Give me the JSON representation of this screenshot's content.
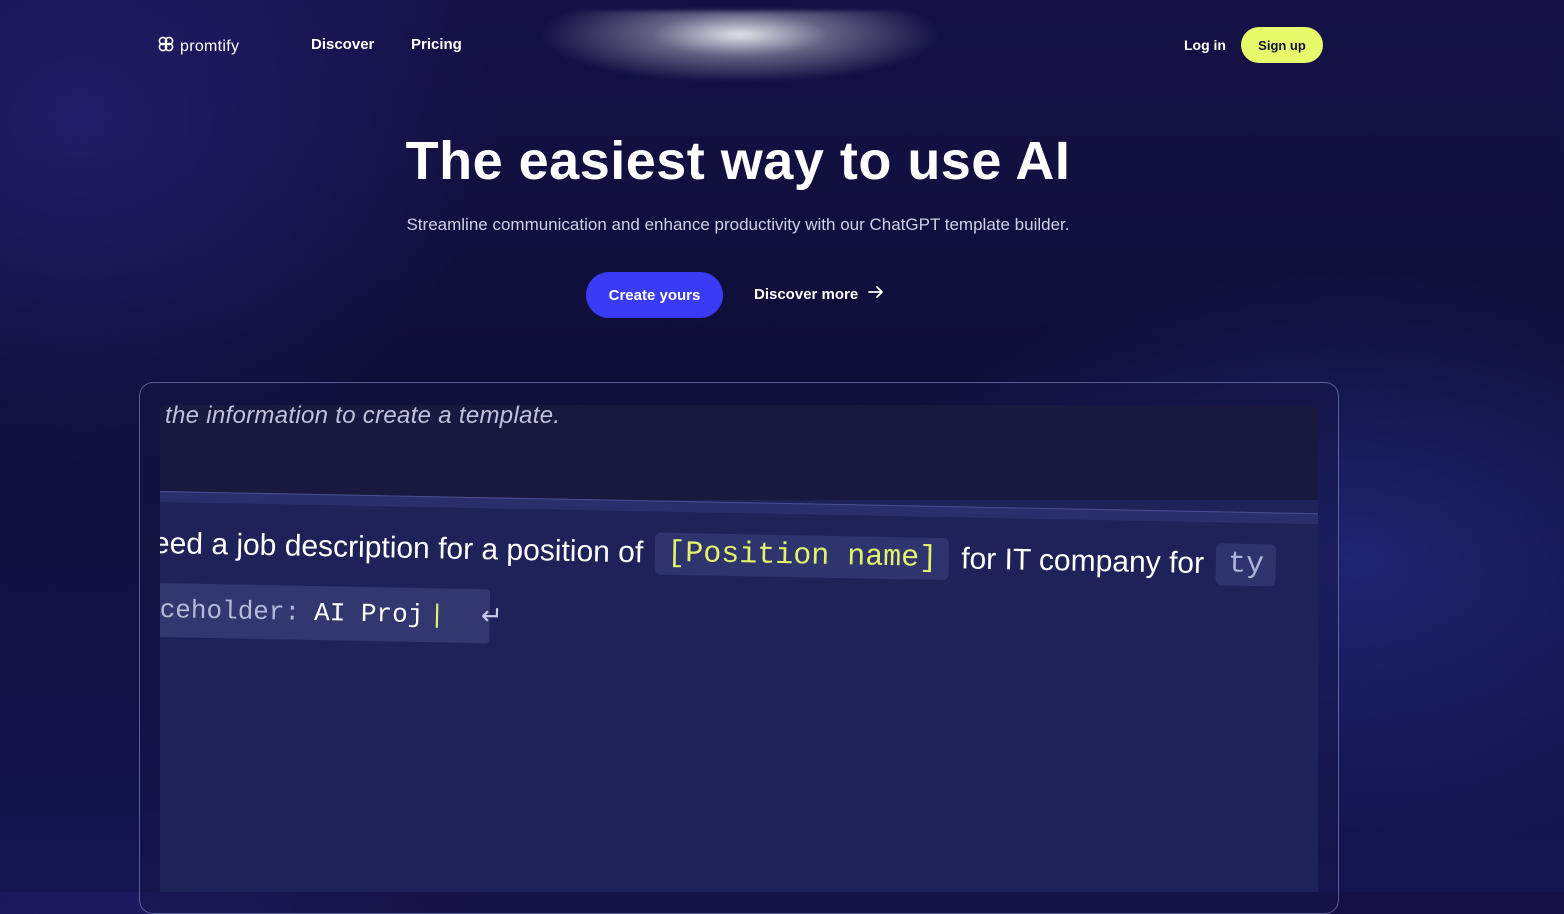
{
  "brand": {
    "name": "promtify",
    "icon": "promtify-logo-icon"
  },
  "nav": {
    "links": [
      "Discover",
      "Pricing"
    ],
    "login": "Log in",
    "signup": "Sign up"
  },
  "hero": {
    "title": "The easiest way to use AI",
    "subtitle": "Streamline communication and enhance productivity with our ChatGPT template builder.",
    "cta_primary": "Create yours",
    "cta_secondary": "Discover more",
    "cta_secondary_icon": "arrow-right-icon"
  },
  "demo": {
    "caption": "the information to create a template.",
    "prompt_start": "eed a job description for a position of",
    "placeholder_chip": "[Position name]",
    "prompt_mid": "for IT company for",
    "chip_ty": "ty",
    "input_label": "ceholder:",
    "input_value": "AI Proj",
    "caret": "|",
    "enter_icon": "return-arrow-icon"
  },
  "colors": {
    "accent_blue": "#3a3bf5",
    "accent_lime": "#e7fb6a",
    "placeholder_text": "#e2f36a"
  }
}
